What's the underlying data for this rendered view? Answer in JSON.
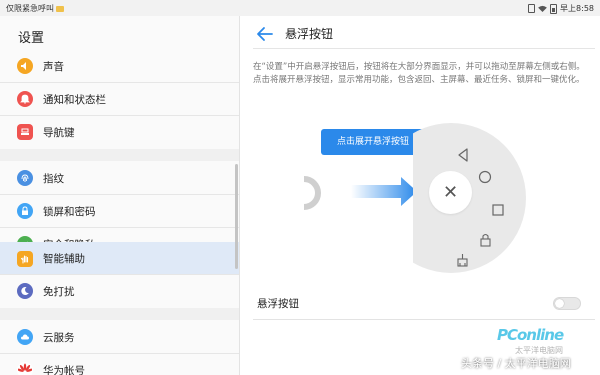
{
  "status_bar": {
    "carrier": "仅限紧急呼叫",
    "time": "早上8:58"
  },
  "sidebar": {
    "title": "设置",
    "items": [
      {
        "label": "声音",
        "icon": "speaker-icon",
        "color": "#f5a623"
      },
      {
        "label": "通知和状态栏",
        "icon": "bell-icon",
        "color": "#ef5350"
      },
      {
        "label": "导航键",
        "icon": "navigation-key-icon",
        "color": "#ef5350"
      },
      {
        "label": "指纹",
        "icon": "fingerprint-icon",
        "color": "#4a90e2"
      },
      {
        "label": "锁屏和密码",
        "icon": "lock-icon",
        "color": "#42a5f5"
      },
      {
        "label": "安全和隐私",
        "icon": "shield-check-icon",
        "color": "#4caf50"
      },
      {
        "label": "智能辅助",
        "icon": "hand-icon",
        "color": "#f5a623",
        "active": true
      },
      {
        "label": "免打扰",
        "icon": "moon-icon",
        "color": "#5c6bc0"
      },
      {
        "label": "云服务",
        "icon": "cloud-icon",
        "color": "#42a5f5"
      },
      {
        "label": "华为帐号",
        "icon": "huawei-logo-icon",
        "color": "#ef5350"
      }
    ]
  },
  "main": {
    "title": "悬浮按钮",
    "description": "在“设置”中开启悬浮按钮后，按钮将在大部分界面显示，并可以拖动至屏幕左侧或右侧。点击将展开悬浮按钮，显示常用功能，包含返回、主屏幕、最近任务、锁屏和一键优化。",
    "illustration": {
      "expand_button_label": "点击展开悬浮按钮"
    },
    "setting": {
      "label": "悬浮按钮",
      "enabled": false
    }
  },
  "watermark": {
    "brand": "PConline",
    "subtitle": "太平洋电脑网",
    "source": "头条号 / 太平洋电脑网"
  },
  "colors": {
    "accent": "#2b89ea",
    "active_bg": "#dfe9f7",
    "disc": "#e9e9e9"
  }
}
